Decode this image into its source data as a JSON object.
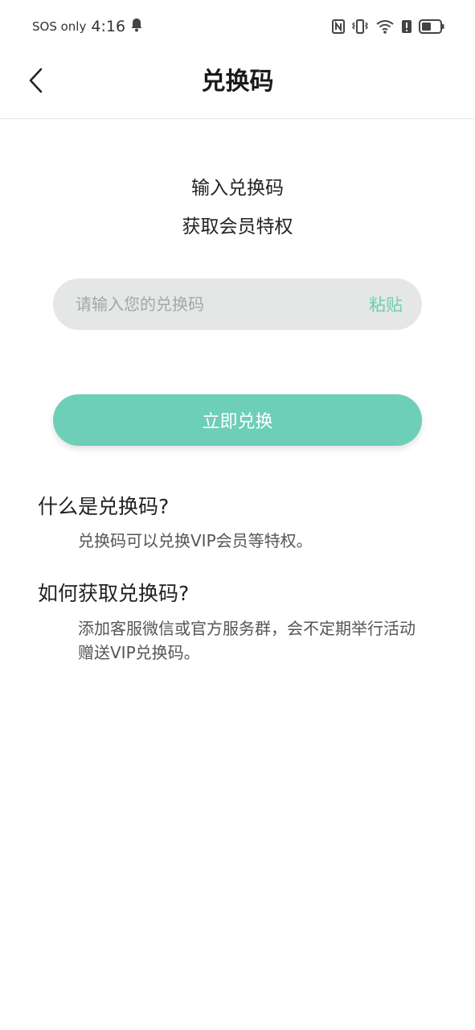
{
  "status_bar": {
    "carrier": "SOS only",
    "time": "4:16"
  },
  "nav": {
    "title": "兑换码"
  },
  "intro": {
    "line1": "输入兑换码",
    "line2": "获取会员特权"
  },
  "code_input": {
    "placeholder": "请输入您的兑换码",
    "value": "",
    "paste_label": "粘贴"
  },
  "redeem_button": {
    "label": "立即兑换"
  },
  "faq": [
    {
      "question": "什么是兑换码?",
      "answer": "兑换码可以兑换VIP会员等特权。"
    },
    {
      "question": "如何获取兑换码?",
      "answer": "添加客服微信或官方服务群，会不定期举行活动赠送VIP兑换码。"
    }
  ],
  "colors": {
    "accent": "#6dcfb7",
    "input_bg": "#e5e7e6"
  },
  "icons": {
    "notification": "bell-icon",
    "nfc": "nfc-icon",
    "vibrate": "vibrate-icon",
    "wifi": "wifi-icon",
    "alert": "alert-icon",
    "battery": "battery-icon",
    "back": "chevron-left-icon"
  }
}
